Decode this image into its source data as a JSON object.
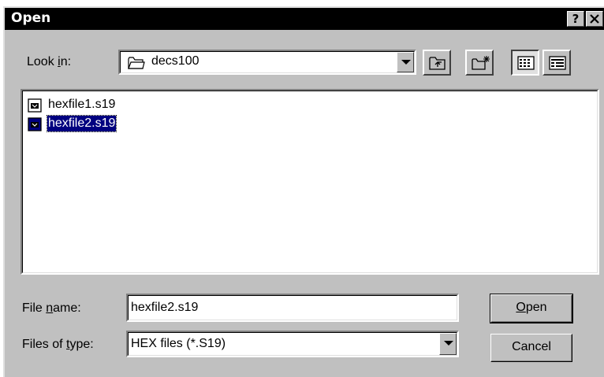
{
  "dialog": {
    "title": "Open",
    "help_symbol": "?",
    "close_symbol": "✕"
  },
  "look_in": {
    "label_pre": "Look ",
    "label_accel": "i",
    "label_post": "n:",
    "value": "decs100"
  },
  "toolbar": {
    "buttons": [
      "up-one-level",
      "create-new-folder",
      "list-view",
      "details-view"
    ]
  },
  "files": [
    {
      "name": "hexfile1.s19",
      "selected": false
    },
    {
      "name": "hexfile2.s19",
      "selected": true
    }
  ],
  "file_name": {
    "label_pre": "File ",
    "label_accel": "n",
    "label_post": "ame:",
    "value": "hexfile2.s19"
  },
  "file_type": {
    "label_pre": "Files of ",
    "label_accel": "t",
    "label_post": "ype:",
    "value": "HEX files (*.S19)"
  },
  "buttons": {
    "open_accel": "O",
    "open_rest": "pen",
    "cancel": "Cancel"
  },
  "colors": {
    "face": "#c0c0c0",
    "titlebar": "#000000",
    "selection": "#000080"
  }
}
